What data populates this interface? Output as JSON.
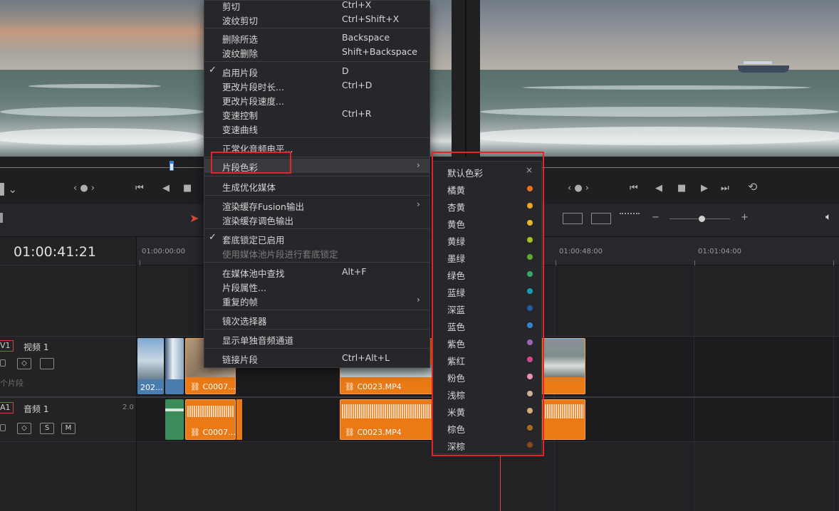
{
  "menu": {
    "items": [
      {
        "label": "剪切",
        "shortcut": "Ctrl+X"
      },
      {
        "label": "波纹剪切",
        "shortcut": "Ctrl+Shift+X"
      },
      {
        "label": "删除所选",
        "shortcut": "Backspace"
      },
      {
        "label": "波纹删除",
        "shortcut": "Shift+Backspace"
      },
      {
        "label": "启用片段",
        "shortcut": "D",
        "checked": true
      },
      {
        "label": "更改片段时长...",
        "shortcut": "Ctrl+D"
      },
      {
        "label": "更改片段速度...",
        "shortcut": ""
      },
      {
        "label": "变速控制",
        "shortcut": "Ctrl+R"
      },
      {
        "label": "变速曲线",
        "shortcut": ""
      },
      {
        "label": "正常化音频电平...",
        "shortcut": ""
      },
      {
        "label": "片段色彩",
        "shortcut": "",
        "submenu": true,
        "active": true
      },
      {
        "label": "生成优化媒体",
        "shortcut": ""
      },
      {
        "label": "渲染缓存Fusion输出",
        "shortcut": "",
        "submenu": true
      },
      {
        "label": "渲染缓存调色输出",
        "shortcut": ""
      },
      {
        "label": "套底锁定已启用",
        "shortcut": "",
        "checked": true
      },
      {
        "label": "使用媒体池片段进行套底锁定",
        "shortcut": "",
        "disabled": true
      },
      {
        "label": "在媒体池中查找",
        "shortcut": "Alt+F"
      },
      {
        "label": "片段属性...",
        "shortcut": ""
      },
      {
        "label": "重复的帧",
        "shortcut": "",
        "submenu": true
      },
      {
        "label": "镜次选择器",
        "shortcut": ""
      },
      {
        "label": "显示单独音频通道",
        "shortcut": ""
      },
      {
        "label": "链接片段",
        "shortcut": "Ctrl+Alt+L"
      }
    ],
    "arrow": "›",
    "check": "✓"
  },
  "colors": {
    "default_label": "默认色彩",
    "close": "×",
    "items": [
      {
        "label": "橘黄",
        "color": "#e8711c"
      },
      {
        "label": "杏黄",
        "color": "#f0a425"
      },
      {
        "label": "黄色",
        "color": "#e2b82a"
      },
      {
        "label": "黄绿",
        "color": "#a4c228"
      },
      {
        "label": "墨绿",
        "color": "#5fa934"
      },
      {
        "label": "绿色",
        "color": "#3aa76d"
      },
      {
        "label": "蓝绿",
        "color": "#1a9ab0"
      },
      {
        "label": "深蓝",
        "color": "#1f5fa0"
      },
      {
        "label": "蓝色",
        "color": "#3784c9"
      },
      {
        "label": "紫色",
        "color": "#9b68b8"
      },
      {
        "label": "紫红",
        "color": "#d34a8b"
      },
      {
        "label": "粉色",
        "color": "#e891bb"
      },
      {
        "label": "浅棕",
        "color": "#c9b096"
      },
      {
        "label": "米黄",
        "color": "#d2ab7e"
      },
      {
        "label": "棕色",
        "color": "#a9691f"
      },
      {
        "label": "深棕",
        "color": "#8a4a22"
      }
    ]
  },
  "timeline": {
    "timecode": "01:00:41:21",
    "ruler": [
      "01:00:00:00",
      "01:00:48:00",
      "01:01:04:00"
    ],
    "video_track": {
      "id": "V1",
      "name": "视频 1",
      "clip_count": "个片段"
    },
    "audio_track": {
      "id": "A1",
      "name": "音频 1",
      "level": "2.0",
      "solo": "S",
      "mute": "M"
    },
    "clips": {
      "v_blue": "202...",
      "v_orange1": "C0007...",
      "v_orange2": "C0023.MP4",
      "a_orange1": "C0007...",
      "a_orange2": "C0023.MP4"
    }
  },
  "accent": "#e0252b"
}
